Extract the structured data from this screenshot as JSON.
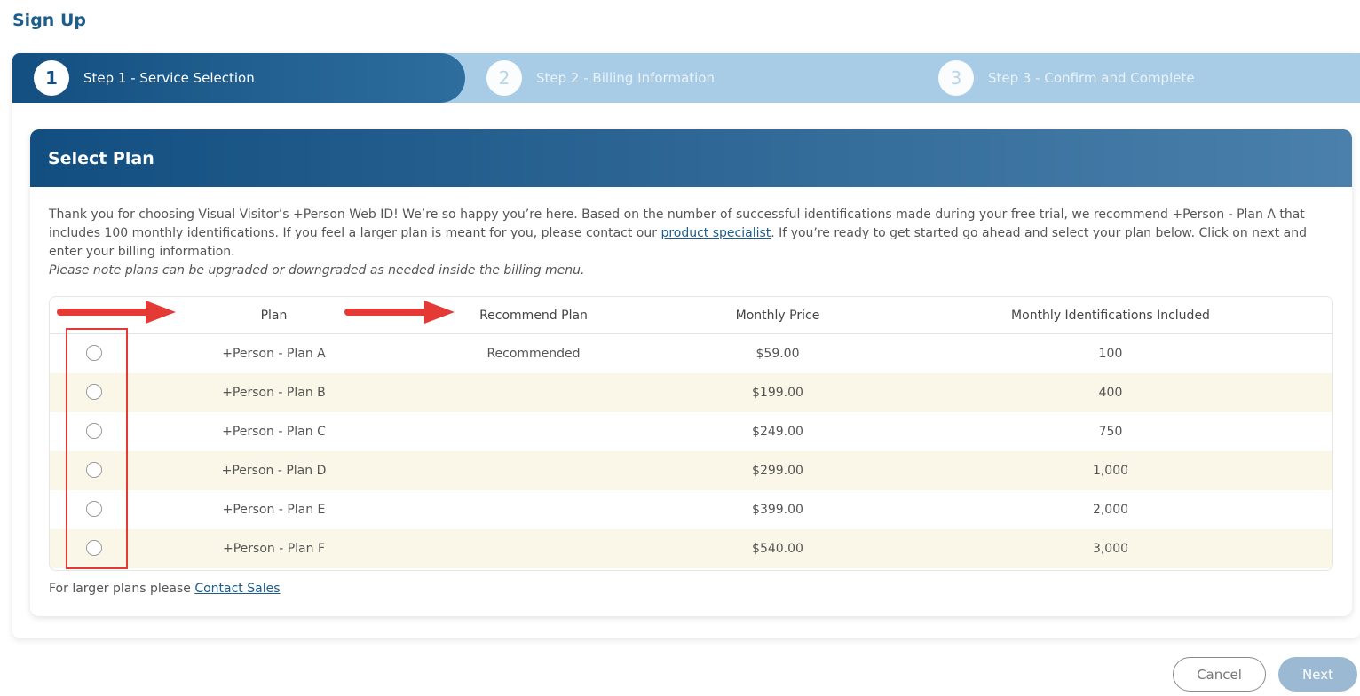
{
  "page": {
    "title": "Sign Up"
  },
  "steps": [
    {
      "number": "1",
      "label": "Step 1 - Service Selection",
      "active": true
    },
    {
      "number": "2",
      "label": "Step 2 - Billing Information",
      "active": false
    },
    {
      "number": "3",
      "label": "Step 3 - Confirm and Complete",
      "active": false
    }
  ],
  "plan_card": {
    "title": "Select Plan",
    "intro_part1": "Thank you for choosing Visual Visitor’s +Person Web ID! We’re so happy you’re here. Based on the number of successful identifications made during your free trial, we recommend +Person - Plan A that includes 100 monthly identifications. If you feel a larger plan is meant for you, please contact our ",
    "intro_link": "product specialist",
    "intro_part2": ". If you’re ready to get started go ahead and select your plan below. Click on next and enter your billing information.",
    "intro_note": "Please note plans can be upgraded or downgraded as needed inside the billing menu.",
    "table": {
      "headers": [
        "Plan",
        "Recommend Plan",
        "Monthly Price",
        "Monthly Identifications Included"
      ],
      "rows": [
        {
          "plan": "+Person - Plan A",
          "recommend": "Recommended",
          "price": "$59.00",
          "identifications": "100"
        },
        {
          "plan": "+Person - Plan B",
          "recommend": "",
          "price": "$199.00",
          "identifications": "400"
        },
        {
          "plan": "+Person - Plan C",
          "recommend": "",
          "price": "$249.00",
          "identifications": "750"
        },
        {
          "plan": "+Person - Plan D",
          "recommend": "",
          "price": "$299.00",
          "identifications": "1,000"
        },
        {
          "plan": "+Person - Plan E",
          "recommend": "",
          "price": "$399.00",
          "identifications": "2,000"
        },
        {
          "plan": "+Person - Plan F",
          "recommend": "",
          "price": "$540.00",
          "identifications": "3,000"
        }
      ]
    },
    "larger_text": "For larger plans please ",
    "larger_link": "Contact Sales"
  },
  "buttons": {
    "cancel": "Cancel",
    "next": "Next"
  },
  "colors": {
    "primary": "#1d5d8c",
    "annotation_red": "#e53935",
    "row_alt": "#fbf7e8"
  }
}
